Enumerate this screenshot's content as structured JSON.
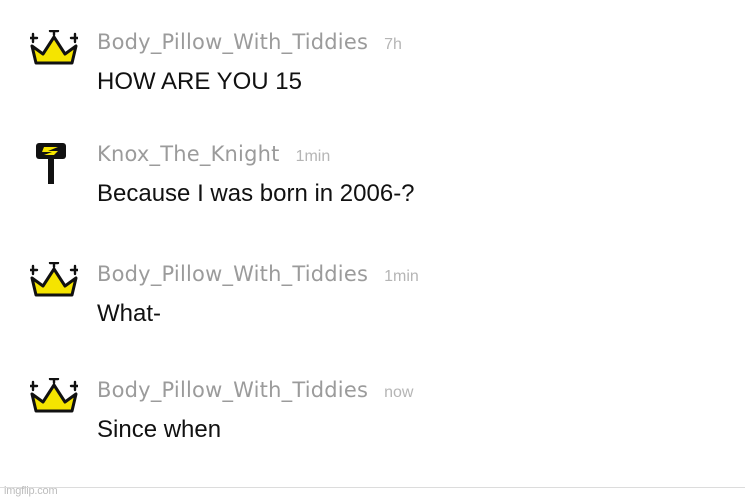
{
  "messages": [
    {
      "username": "Body_Pillow_With_Tiddies",
      "time": "7h",
      "text": "HOW ARE YOU 15",
      "badge_icon": "crown-icon",
      "badge_color": "#f5e400"
    },
    {
      "username": "Knox_The_Knight",
      "time": "1min",
      "text": "Because I was born in 2006-?",
      "badge_icon": "hammer-icon",
      "badge_color": "#f5e400"
    },
    {
      "username": "Body_Pillow_With_Tiddies",
      "time": "1min",
      "text": "What-",
      "badge_icon": "crown-icon",
      "badge_color": "#f5e400"
    },
    {
      "username": "Body_Pillow_With_Tiddies",
      "time": "now",
      "text": "Since when",
      "badge_icon": "crown-icon",
      "badge_color": "#f5e400"
    }
  ],
  "watermark": "imgflip.com"
}
